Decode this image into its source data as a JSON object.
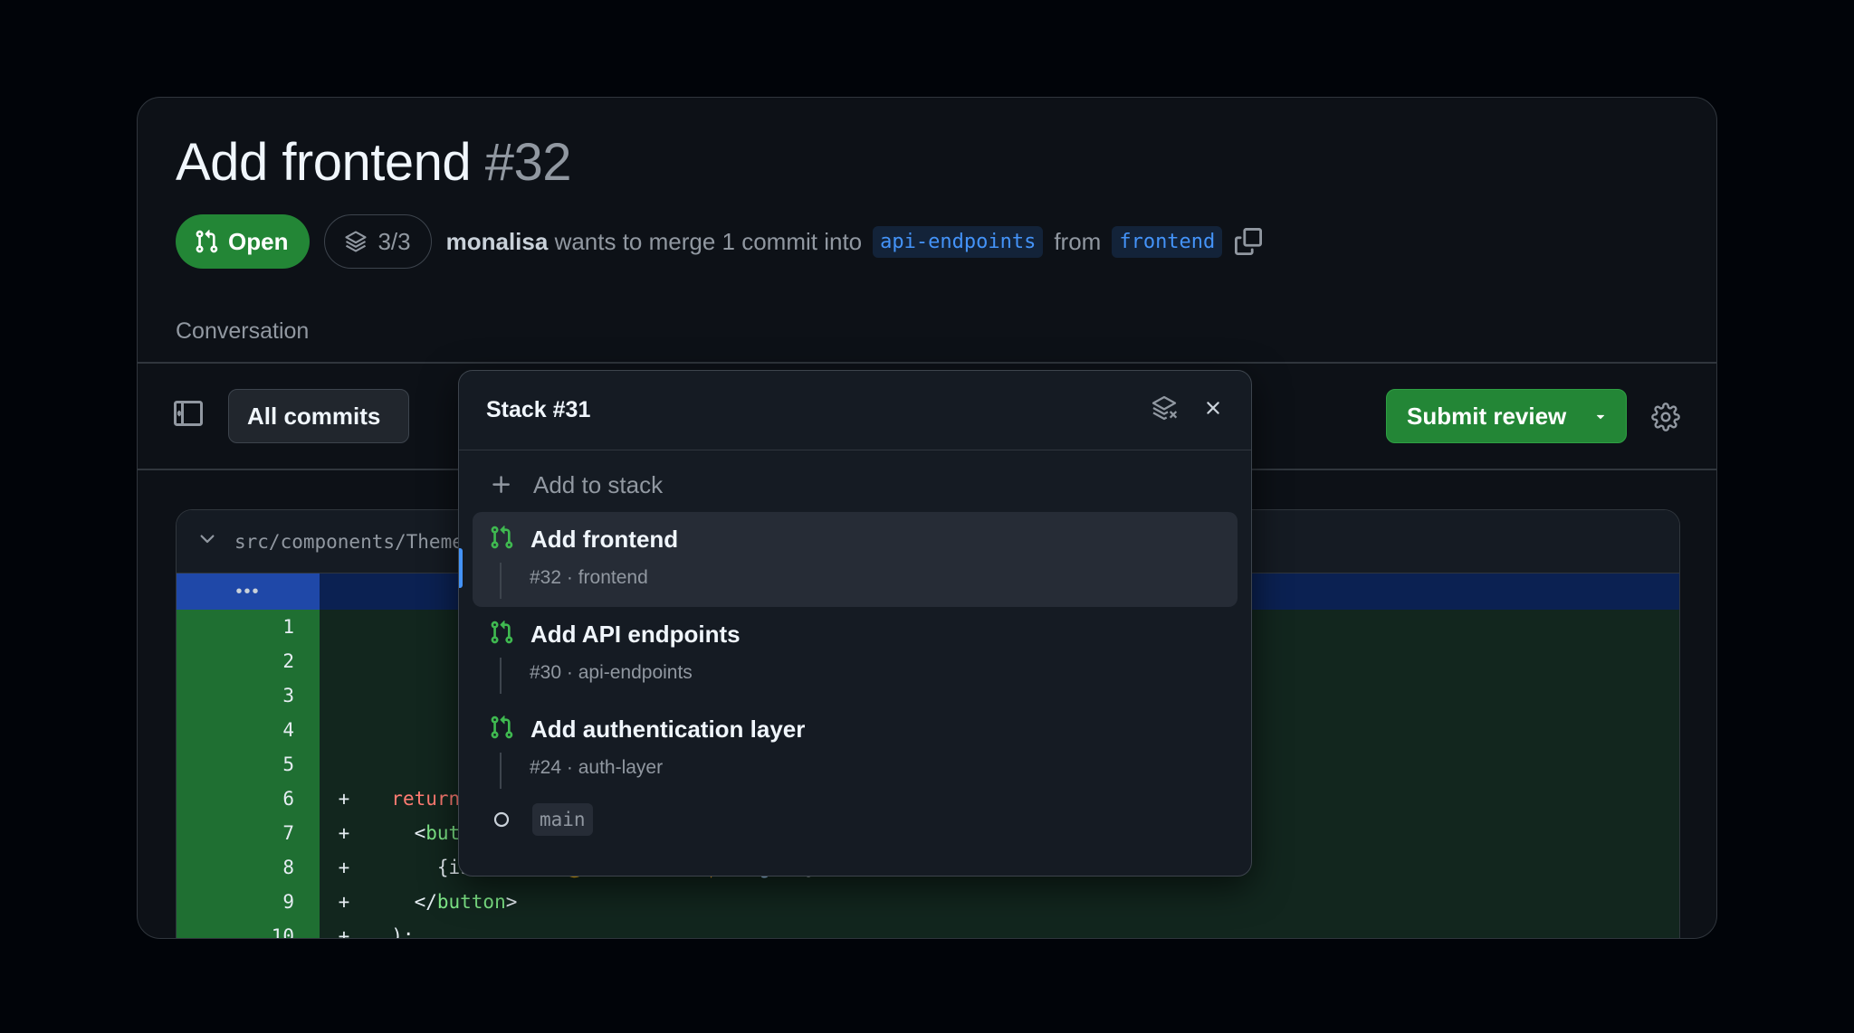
{
  "pr": {
    "title": "Add frontend",
    "number": "#32",
    "status": "Open",
    "stack_position": "3/3",
    "author": "monalisa",
    "merge_text": "wants to merge 1 commit into",
    "base_branch": "api-endpoints",
    "from_text": "from",
    "head_branch": "frontend"
  },
  "tabs": {
    "conversation": "Conversation"
  },
  "toolbar": {
    "commits_filter": "All commits",
    "submit_label": "Submit review"
  },
  "diff": {
    "file_path": "src/components/ThemeToggle.tsx",
    "hunk_marker": "•••",
    "lines": [
      {
        "n": "1",
        "sign": "",
        "code": ""
      },
      {
        "n": "2",
        "sign": "",
        "code": ""
      },
      {
        "n": "3",
        "sign": "",
        "code": ""
      },
      {
        "n": "4",
        "sign": "",
        "code": ""
      },
      {
        "n": "5",
        "sign": "",
        "code": ""
      },
      {
        "n": "6",
        "sign": "+",
        "code": "return ("
      },
      {
        "n": "7",
        "sign": "+",
        "code": "<button className=\"theme-toggle\" onClick={() => setIsDark(!isDark)}>"
      },
      {
        "n": "8",
        "sign": "+",
        "code": "{isDark ? '🌙 Dark' : '☀️ Light'}"
      },
      {
        "n": "9",
        "sign": "+",
        "code": "</button>"
      },
      {
        "n": "10",
        "sign": "+",
        "code": ");"
      }
    ]
  },
  "stack_popover": {
    "title": "Stack #31",
    "add_label": "Add to stack",
    "items": [
      {
        "title": "Add frontend",
        "number": "#32",
        "branch": "frontend",
        "active": true
      },
      {
        "title": "Add API endpoints",
        "number": "#30",
        "branch": "api-endpoints",
        "active": false
      },
      {
        "title": "Add authentication layer",
        "number": "#24",
        "branch": "auth-layer",
        "active": false
      }
    ],
    "base": "main"
  },
  "colors": {
    "background": "#010409",
    "panel": "#0d1117",
    "accent_green": "#238636",
    "accent_blue": "#4493f8"
  }
}
